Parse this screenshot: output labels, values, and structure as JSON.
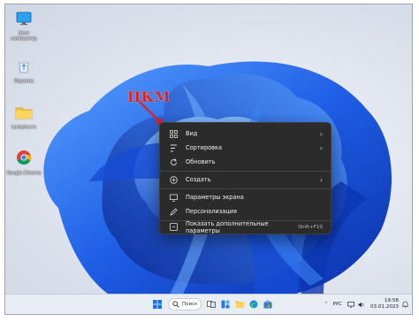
{
  "annotation": {
    "label": "ПКМ",
    "color": "#e0201c"
  },
  "desktop_icons": [
    {
      "label": "Этот компьютер",
      "icon": "monitor-icon"
    },
    {
      "label": "Корзина",
      "icon": "recycle-bin-icon"
    },
    {
      "label": "Lumpics.ru",
      "icon": "folder-icon"
    },
    {
      "label": "Google Chrome",
      "icon": "chrome-icon"
    }
  ],
  "context_menu": {
    "items": [
      {
        "label": "Вид",
        "icon": "view-grid-icon",
        "submenu": true
      },
      {
        "label": "Сортировка",
        "icon": "sort-icon",
        "submenu": true
      },
      {
        "label": "Обновить",
        "icon": "refresh-icon",
        "submenu": false
      },
      {
        "label": "Создать",
        "icon": "new-plus-icon",
        "submenu": true
      },
      {
        "label": "Параметры экрана",
        "icon": "display-settings-icon",
        "submenu": false
      },
      {
        "label": "Персонализация",
        "icon": "personalize-pen-icon",
        "submenu": false
      },
      {
        "label": "Показать дополнительные параметры",
        "icon": "more-options-icon",
        "submenu": false,
        "shortcut": "Shift+F10"
      }
    ]
  },
  "taskbar": {
    "search_label": "Поиск",
    "language": "РУС",
    "time": "19:58",
    "date": "03.01.2023"
  },
  "colors": {
    "wallpaper_blue": "#1f5fe0",
    "menu_bg": "#2b2b2b"
  }
}
